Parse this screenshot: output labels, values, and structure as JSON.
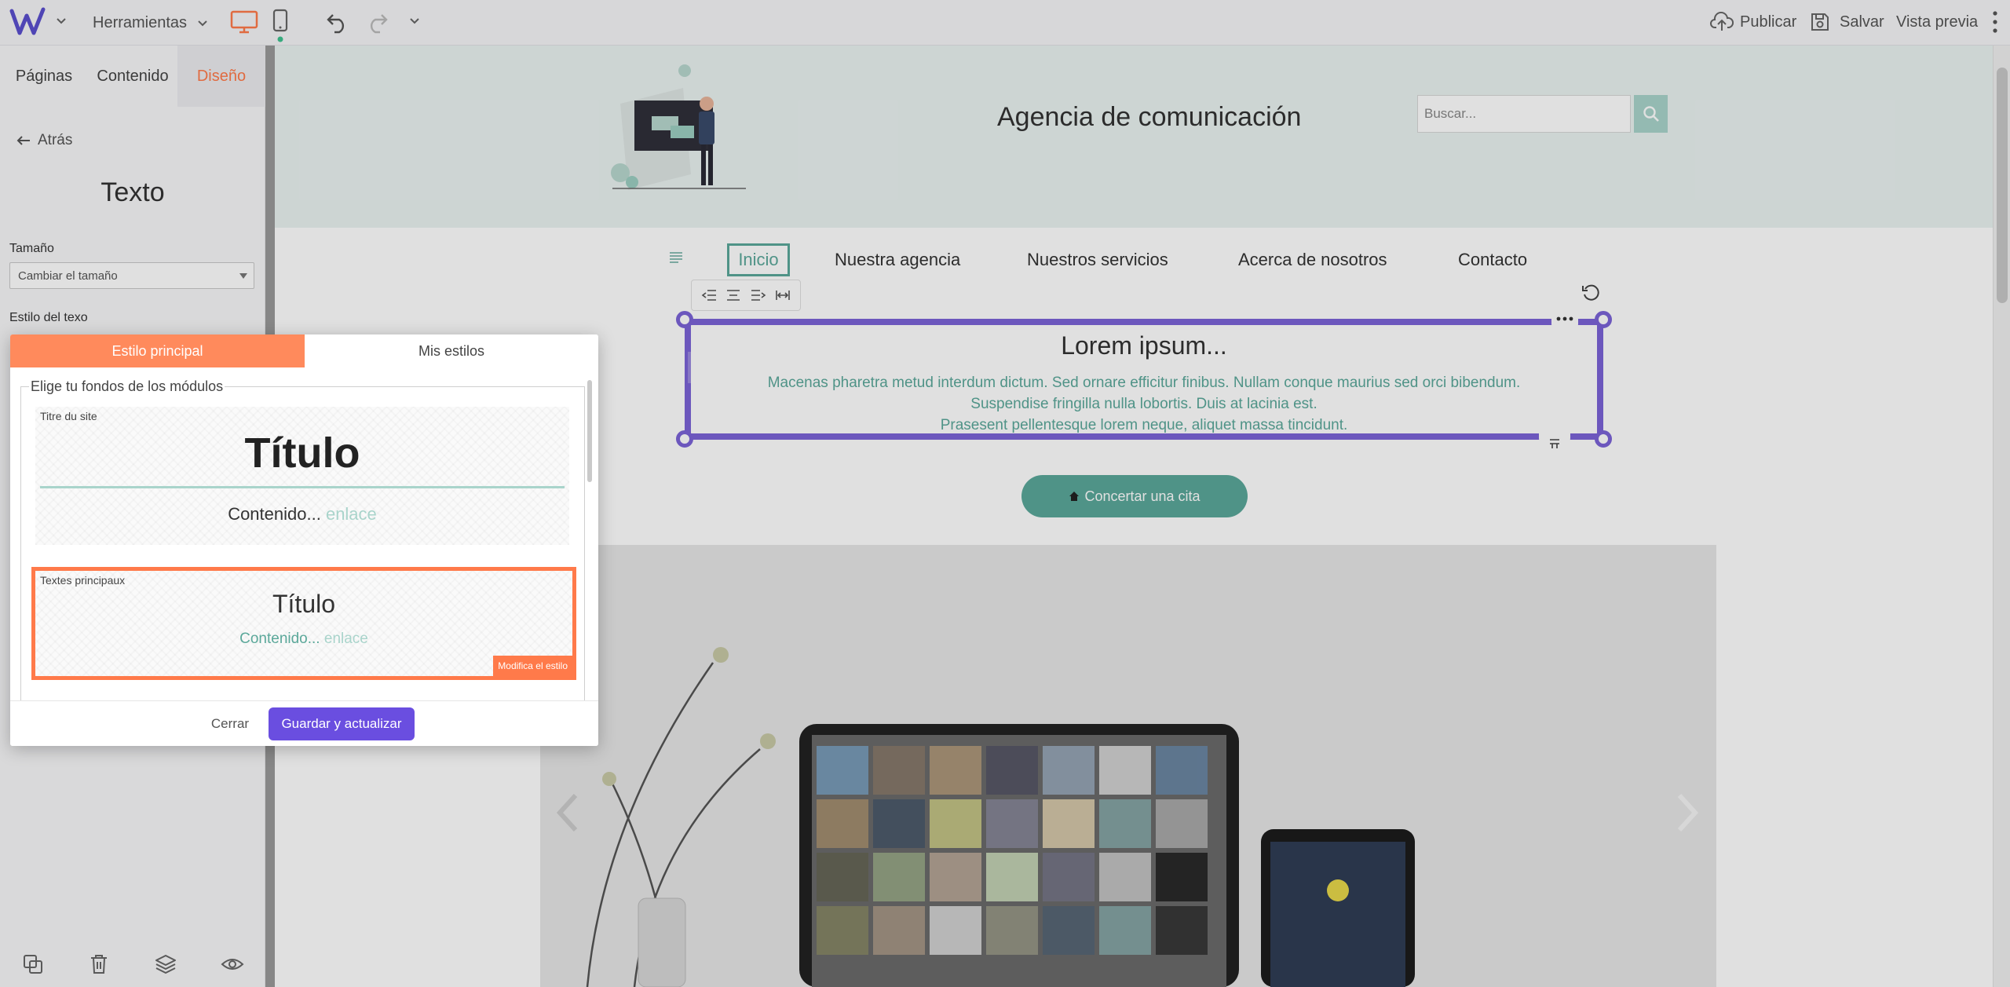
{
  "topbar": {
    "logo": "W",
    "tools_label": "Herramientas",
    "publish_label": "Publicar",
    "save_label": "Salvar",
    "preview_label": "Vista previa",
    "icons": [
      "logo-icon",
      "chevron-down-icon",
      "desktop-icon",
      "mobile-icon",
      "undo-icon",
      "redo-icon",
      "history-chevron-icon",
      "cloud-upload-icon",
      "save-icon",
      "more-vertical-icon"
    ]
  },
  "sidebar": {
    "tabs": [
      {
        "label": "Páginas",
        "active": false
      },
      {
        "label": "Contenido",
        "active": false
      },
      {
        "label": "Diseño",
        "active": true
      }
    ],
    "back_label": "Atrás",
    "panel_title": "Texto",
    "size_label": "Tamaño",
    "size_select": "Cambiar el tamaño",
    "text_style_label": "Estilo del texo",
    "bottom_icons": [
      "duplicate-icon",
      "trash-icon",
      "layers-icon",
      "eye-icon"
    ]
  },
  "modal": {
    "tab_main": "Estilo principal",
    "tab_mine": "Mis estilos",
    "legend": "Elige tu fondos de los módulos",
    "card1": {
      "tag": "Titre du site",
      "title": "Título",
      "content": "Contenido...",
      "link": "enlace"
    },
    "card2": {
      "tag": "Textes principaux",
      "title": "Título",
      "content": "Contenido...",
      "link": "enlace",
      "edit_button": "Modifica el estilo"
    },
    "close_label": "Cerrar",
    "save_label": "Guardar y actualizar"
  },
  "site": {
    "title": "Agencia de comunicación",
    "search_placeholder": "Buscar...",
    "nav": [
      "Inicio",
      "Nuestra agencia",
      "Nuestros servicios",
      "Acerca de nosotros",
      "Contacto"
    ],
    "active_nav": "Inicio",
    "text_block": {
      "heading": "Lorem ipsum...",
      "lines": [
        "Macenas pharetra metud interdum dictum. Sed ornare efficitur finibus. Nullam conque maurius sed orci bibendum.",
        "Suspendise fringilla nulla lobortis. Duis at lacinia est.",
        "Prasesent pellentesque lorem neque, aliquet massa tincidunt."
      ]
    },
    "cta_label": "Concertar una cita"
  },
  "colors": {
    "accent_orange": "#ff7a4a",
    "accent_purple": "#6a4ee0",
    "selection_purple": "#7b63d8",
    "teal": "#5ba89a",
    "teal_light": "#a9d4cb",
    "header_bg": "#eaf3f1"
  }
}
